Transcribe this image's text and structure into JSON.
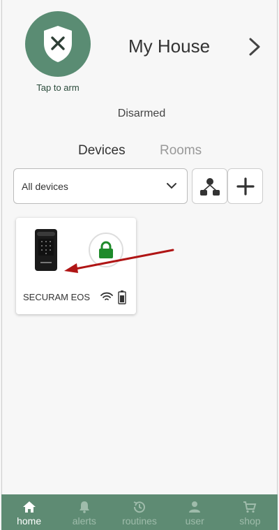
{
  "header": {
    "arm_caption": "Tap to arm",
    "house_title": "My House",
    "status": "Disarmed"
  },
  "tabs": [
    {
      "label": "Devices",
      "active": true
    },
    {
      "label": "Rooms",
      "active": false
    }
  ],
  "filter": {
    "selected": "All devices"
  },
  "devices": [
    {
      "name": "SECURAM EOS",
      "lock_state": "locked",
      "lock_color": "#1e8a2a"
    }
  ],
  "nav": [
    {
      "label": "home",
      "icon": "home-icon",
      "active": true
    },
    {
      "label": "alerts",
      "icon": "bell-icon",
      "active": false
    },
    {
      "label": "routines",
      "icon": "routines-icon",
      "active": false
    },
    {
      "label": "user",
      "icon": "user-icon",
      "active": false
    },
    {
      "label": "shop",
      "icon": "cart-icon",
      "active": false
    }
  ],
  "colors": {
    "brand_green": "#5a8c73",
    "nav_bg": "#5e8b73",
    "annotation_arrow": "#b01515"
  }
}
